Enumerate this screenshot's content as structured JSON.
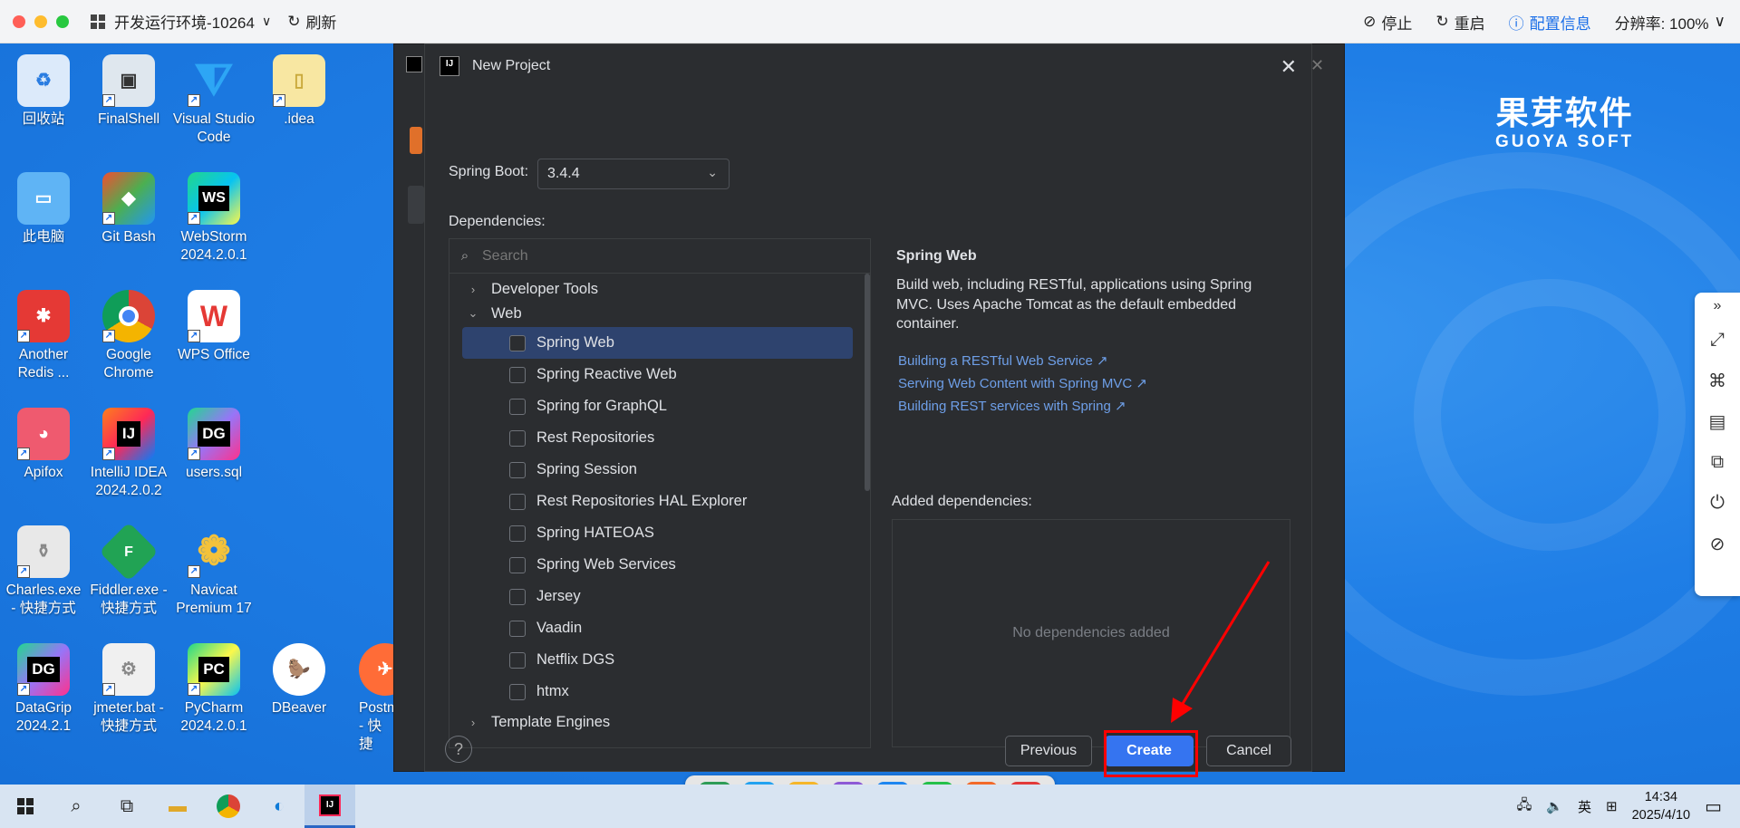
{
  "viewer": {
    "title": "开发运行环境-10264",
    "refresh": "刷新",
    "stop": "停止",
    "restart": "重启",
    "config": "配置信息",
    "resolution": "分辨率: 100%"
  },
  "brand": {
    "cn": "果芽软件",
    "en": "GUOYA SOFT"
  },
  "desktop_icons": [
    {
      "label": "回收站"
    },
    {
      "label": "FinalShell"
    },
    {
      "label": "Visual Studio Code"
    },
    {
      "label": ".idea"
    },
    {
      "label": "此电脑"
    },
    {
      "label": "Git Bash"
    },
    {
      "label": "WebStorm 2024.2.0.1"
    },
    {
      "label": "Another Redis ..."
    },
    {
      "label": "Google Chrome"
    },
    {
      "label": "WPS Office"
    },
    {
      "label": "Apifox"
    },
    {
      "label": "IntelliJ IDEA 2024.2.0.2"
    },
    {
      "label": "users.sql"
    },
    {
      "label": "Charles.exe - 快捷方式"
    },
    {
      "label": "Fiddler.exe - 快捷方式"
    },
    {
      "label": "Navicat Premium 17"
    },
    {
      "label": "DataGrip 2024.2.1"
    },
    {
      "label": "jmeter.bat - 快捷方式"
    },
    {
      "label": "PyCharm 2024.2.0.1"
    },
    {
      "label": "DBeaver"
    },
    {
      "label": "Postm - 快捷"
    }
  ],
  "dialog": {
    "title": "New Project",
    "spring_boot_label": "Spring Boot:",
    "spring_boot_version": "3.4.4",
    "dependencies_label": "Dependencies:",
    "search_placeholder": "Search",
    "tree": {
      "developer_tools": "Developer Tools",
      "web": "Web",
      "template_engines": "Template Engines",
      "web_items": [
        "Spring Web",
        "Spring Reactive Web",
        "Spring for GraphQL",
        "Rest Repositories",
        "Spring Session",
        "Rest Repositories HAL Explorer",
        "Spring HATEOAS",
        "Spring Web Services",
        "Jersey",
        "Vaadin",
        "Netflix DGS",
        "htmx"
      ]
    },
    "info": {
      "title": "Spring Web",
      "description": "Build web, including RESTful, applications using Spring MVC. Uses Apache Tomcat as the default embedded container.",
      "links": [
        "Building a RESTful Web Service",
        "Serving Web Content with Spring MVC",
        "Building REST services with Spring"
      ]
    },
    "added_label": "Added dependencies:",
    "no_deps": "No dependencies added",
    "help": "?",
    "buttons": {
      "previous": "Previous",
      "create": "Create",
      "cancel": "Cancel"
    }
  },
  "taskbar": {
    "lang": "英",
    "time": "14:34",
    "date": "2025/4/10"
  }
}
